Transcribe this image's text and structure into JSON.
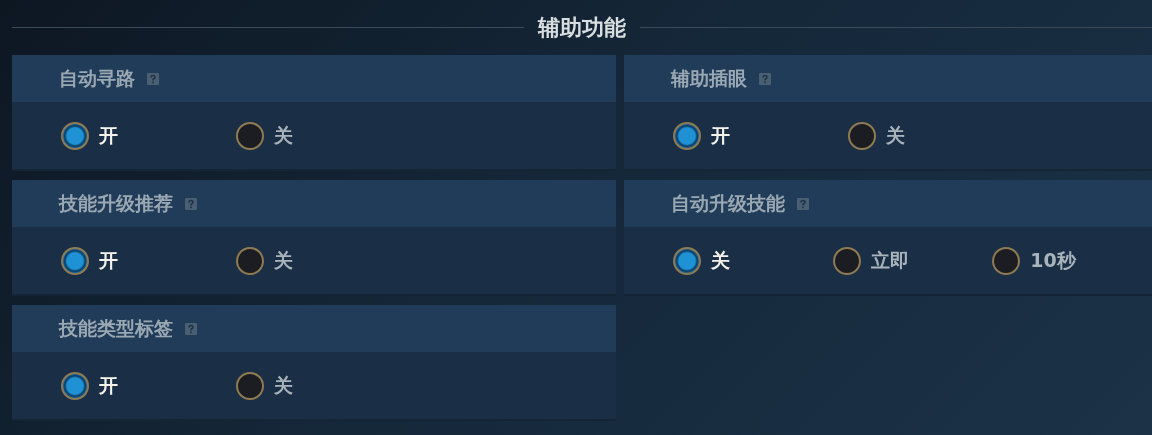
{
  "title": "辅助功能",
  "settings": [
    {
      "label": "自动寻路",
      "options": [
        {
          "label": "开",
          "selected": true
        },
        {
          "label": "关",
          "selected": false
        }
      ]
    },
    {
      "label": "辅助插眼",
      "options": [
        {
          "label": "开",
          "selected": true
        },
        {
          "label": "关",
          "selected": false
        }
      ]
    },
    {
      "label": "技能升级推荐",
      "options": [
        {
          "label": "开",
          "selected": true
        },
        {
          "label": "关",
          "selected": false
        }
      ]
    },
    {
      "label": "自动升级技能",
      "options": [
        {
          "label": "关",
          "selected": true
        },
        {
          "label": "立即",
          "selected": false
        },
        {
          "label": "10秒",
          "selected": false
        }
      ]
    },
    {
      "label": "技能类型标签",
      "options": [
        {
          "label": "开",
          "selected": true
        },
        {
          "label": "关",
          "selected": false
        }
      ]
    }
  ]
}
